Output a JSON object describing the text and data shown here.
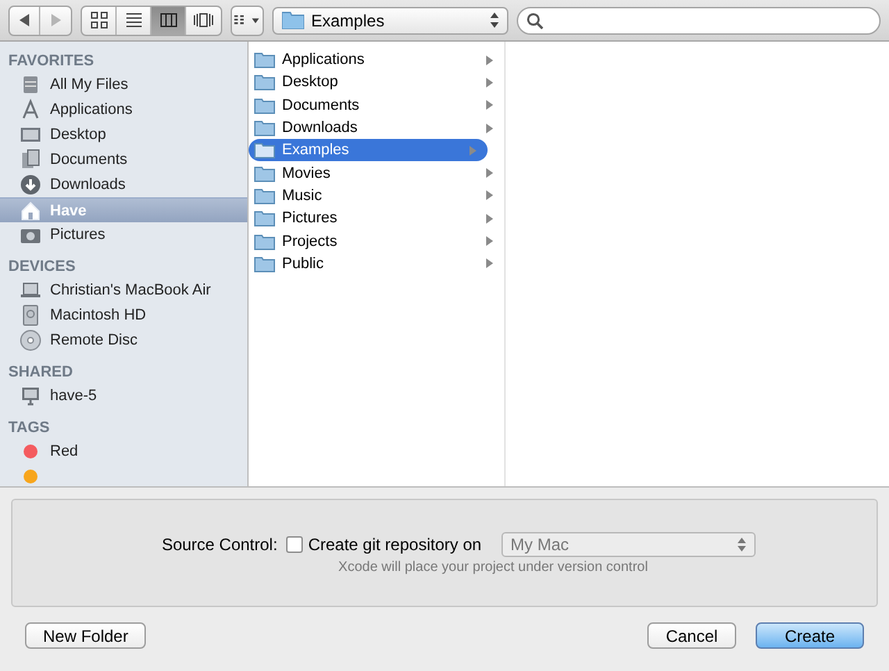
{
  "toolbar": {
    "nav": [
      {
        "kind": "back",
        "disabled": false
      },
      {
        "kind": "forward",
        "disabled": true
      }
    ],
    "views": [
      {
        "kind": "icon",
        "selected": false
      },
      {
        "kind": "list",
        "selected": false
      },
      {
        "kind": "column",
        "selected": true
      },
      {
        "kind": "coverflow",
        "selected": false
      }
    ],
    "path_popup": "Examples"
  },
  "sidebar": {
    "sections": [
      {
        "title": "FAVORITES",
        "items": [
          {
            "label": "All My Files",
            "selected": false
          },
          {
            "label": "Applications",
            "selected": false
          },
          {
            "label": "Desktop",
            "selected": false
          },
          {
            "label": "Documents",
            "selected": false
          },
          {
            "label": "Downloads",
            "selected": false
          },
          {
            "label": "Have",
            "selected": true
          },
          {
            "label": "Pictures",
            "selected": false
          }
        ]
      },
      {
        "title": "DEVICES",
        "items": [
          {
            "label": "Christian's MacBook Air",
            "selected": false
          },
          {
            "label": "Macintosh HD",
            "selected": false
          },
          {
            "label": "Remote Disc",
            "selected": false
          }
        ]
      },
      {
        "title": "SHARED",
        "items": [
          {
            "label": "have-5",
            "selected": false
          }
        ]
      },
      {
        "title": "TAGS",
        "items": [
          {
            "label": "Red",
            "color": "#f45b5f",
            "selected": false
          },
          {
            "color": "#f7a51c",
            "selected": false
          }
        ]
      }
    ]
  },
  "columns": [
    {
      "items": [
        {
          "label": "Applications",
          "selected": false
        },
        {
          "label": "Desktop",
          "selected": false
        },
        {
          "label": "Documents",
          "selected": false
        },
        {
          "label": "Downloads",
          "selected": false
        },
        {
          "label": "Examples",
          "selected": true
        },
        {
          "label": "Movies",
          "selected": false
        },
        {
          "label": "Music",
          "selected": false
        },
        {
          "label": "Pictures",
          "selected": false
        },
        {
          "label": "Projects",
          "selected": false
        },
        {
          "label": "Public",
          "selected": false
        }
      ]
    }
  ],
  "source_control": {
    "label": "Source Control:",
    "checkbox_label": "Create git repository on",
    "checked": false,
    "popup": "My Mac",
    "hint": "Xcode will place your project under version control"
  },
  "buttons": [
    {
      "label": "New Folder",
      "kind": "normal"
    },
    {
      "label": "Cancel",
      "kind": "normal"
    },
    {
      "label": "Create",
      "kind": "default"
    }
  ]
}
